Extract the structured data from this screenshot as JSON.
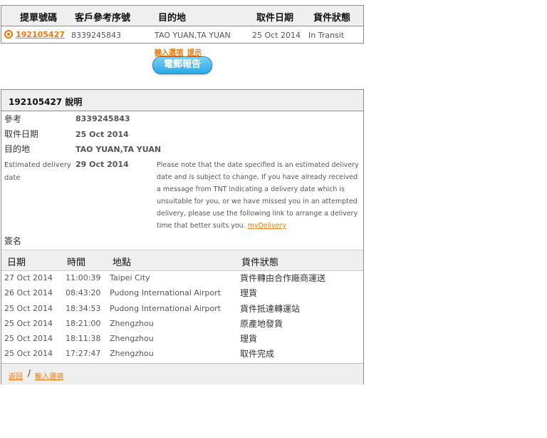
{
  "summary": {
    "headers": [
      "提單號碼",
      "客戶參考序號",
      "目的地",
      "取件日期",
      "貨件狀態"
    ],
    "row": {
      "tracking_number": "192105427",
      "reference": "8339245843",
      "destination": "TAO YUAN,TA YUAN",
      "pickup_date": "25 Oct 2014",
      "status": "In Transit"
    }
  },
  "links": {
    "input_options": "輸入選項",
    "hint": "提示"
  },
  "email_button": "電郵報告",
  "details": {
    "title": "192105427 說明",
    "labels": {
      "reference": "參考",
      "pickup_date": "取件日期",
      "destination": "目的地",
      "estimated_delivery": "Estimated delivery date",
      "signature": "簽名"
    },
    "values": {
      "reference": "8339245843",
      "pickup_date": "25 Oct 2014",
      "destination": "TAO YUAN,TA YUAN",
      "estimated_delivery": "29 Oct 2014"
    },
    "note": "Please note that the date specified is an estimated delivery date and is subject to change. If you have already received a message from TNT indicating a delivery date which is unsuitable for you, or we have missed you in an attempted delivery, please use the following link to arrange a delivery time that better suits you.",
    "note_link": "myDelivery"
  },
  "history": {
    "headers": [
      "日期",
      "時間",
      "地點",
      "貨件狀態"
    ],
    "rows": [
      {
        "date": "27 Oct 2014",
        "time": "11:00:39",
        "location": "Taipei City",
        "status": "貨件轉由合作廠商運送"
      },
      {
        "date": "26 Oct 2014",
        "time": "08:43:20",
        "location": "Pudong International Airport",
        "status": "理貨"
      },
      {
        "date": "25 Oct 2014",
        "time": "18:34:53",
        "location": "Pudong International Airport",
        "status": "貨件抵達轉運站"
      },
      {
        "date": "25 Oct 2014",
        "time": "18:21:00",
        "location": "Zhengzhou",
        "status": "原產地發貨"
      },
      {
        "date": "25 Oct 2014",
        "time": "18:11:38",
        "location": "Zhengzhou",
        "status": "理貨"
      },
      {
        "date": "25 Oct 2014",
        "time": "17:27:47",
        "location": "Zhengzhou",
        "status": "取件完成"
      }
    ]
  },
  "footer": {
    "back": "返回",
    "input_options": "輸入選項",
    "separator": "/"
  }
}
